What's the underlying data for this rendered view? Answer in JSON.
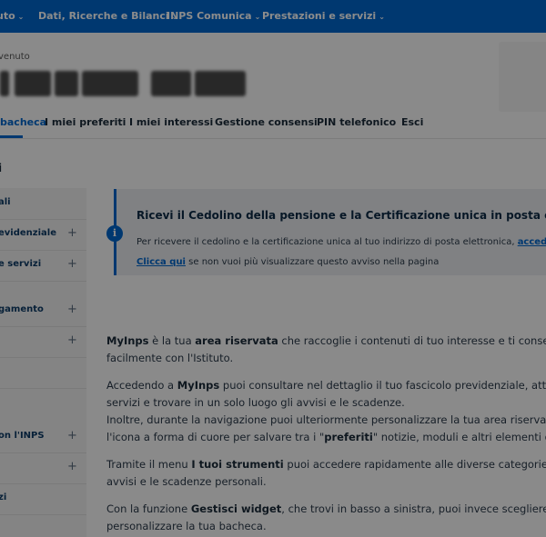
{
  "topnav": {
    "items": [
      "uto",
      "Dati, Ricerche e Bilanci",
      "INPS Comunica",
      "Prestazioni e servizi"
    ]
  },
  "header": {
    "welcome": "venuto"
  },
  "tabs": [
    "bacheca",
    "I miei preferiti",
    "I miei interessi",
    "Gestione consensi",
    "PIN telefonico",
    "Esci"
  ],
  "breadcrumb": "i",
  "sidebar": {
    "items": [
      {
        "label": "ali",
        "expandable": false
      },
      {
        "label": "evidenziale",
        "expandable": true
      },
      {
        "label": "e servizi",
        "expandable": true
      },
      {
        "label": "gamento",
        "expandable": true
      },
      {
        "label": "",
        "expandable": true
      },
      {
        "label": "",
        "expandable": false
      },
      {
        "label": "on l'INPS",
        "expandable": true
      },
      {
        "label": "",
        "expandable": true
      },
      {
        "label": "zi",
        "expandable": false
      }
    ],
    "plus_symbol": "+"
  },
  "notice": {
    "title": "Ricevi il Cedolino della pensione e la Certificazione unica in posta elettronica",
    "line1_text": "Per ricevere il cedolino e la certificazione unica al tuo indirizzo di posta elettronica, ",
    "line1_link": "accedi al servizio",
    "line2_link": "Clicca qui",
    "line2_text": " se non vuoi più visualizzare questo avviso nella pagina",
    "icon": "info-icon"
  },
  "content": {
    "p1a_b": "MyInps",
    "p1a_t": " è la tua ",
    "p1a_b2": "area riservata",
    "p1a_t2": " che raccoglie i contenuti di tuo interesse e ti consente di",
    "p1b": "facilmente con l'Istituto.",
    "p2a_t": "Accedendo a ",
    "p2a_b": "MyInps",
    "p2a_t2": " puoi consultare nel dettaglio il tuo fascicolo previdenziale, attivare",
    "p2b": "servizi e trovare in un solo luogo gli avvisi e le scadenze.",
    "p2c": "Inoltre, durante la navigazione puoi ulteriormente personalizzare la tua area riservata, u",
    "p2d_t": "l'icona a forma di cuore per salvare tra i \"",
    "p2d_b": "preferiti",
    "p2d_t2": "\" notizie, moduli e altri elementi di tuo",
    "p3a_t": "Tramite il menu ",
    "p3a_b": "I tuoi strumenti",
    "p3a_t2": " puoi accedere rapidamente alle diverse categorie di s",
    "p3b": "avvisi e le scadenze personali.",
    "p4a_t": "Con la funzione ",
    "p4a_b": "Gestisci widget",
    "p4a_t2": ", che trovi in basso a sinistra, puoi invece scegliere con",
    "p4b": "personalizzare la tua bacheca."
  },
  "colors": {
    "primary": "#0066cc",
    "overlay": "rgba(0,0,0,0.45)"
  }
}
